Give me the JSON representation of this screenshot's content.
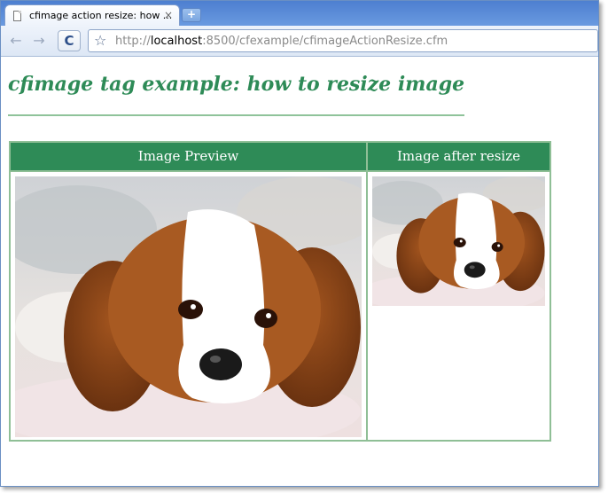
{
  "browser": {
    "tab_title": "cfimage action resize: how ...",
    "tab_close_glyph": "×",
    "new_tab_glyph": "+",
    "back_glyph": "←",
    "forward_glyph": "→",
    "reload_glyph": "C",
    "star_glyph": "☆",
    "url_prefix": "http://",
    "url_host": "localhost",
    "url_rest": ":8500/cfexample/cfimageActionResize.cfm"
  },
  "page": {
    "title": "cfimage tag example: how to resize image",
    "table": {
      "col1_header": "Image Preview",
      "col2_header": "Image after resize"
    },
    "accent_color": "#2e8b57"
  },
  "icons": {
    "tab_page": "page-icon",
    "close": "close-icon",
    "new_tab": "new-tab-icon",
    "back": "back-arrow-icon",
    "forward": "forward-arrow-icon",
    "reload": "reload-icon",
    "bookmark": "star-icon"
  },
  "images": {
    "preview_subject": "puppy photo",
    "resized_subject": "puppy photo resized"
  }
}
